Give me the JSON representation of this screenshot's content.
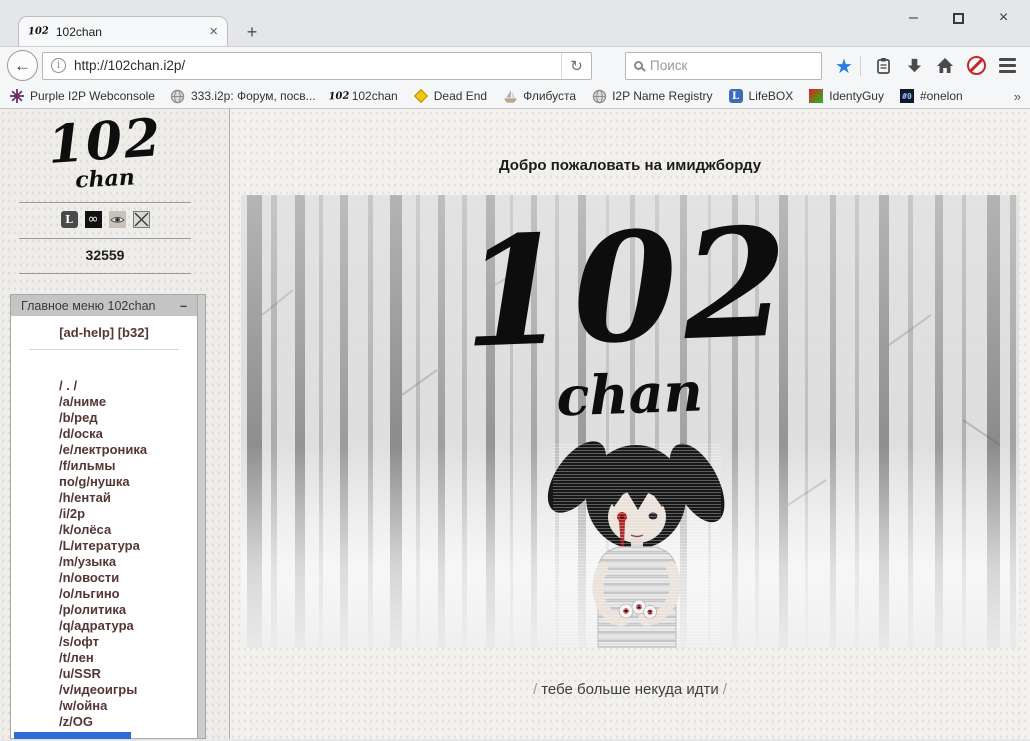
{
  "window": {
    "glyphs": {
      "minimize": "–",
      "close": "×"
    }
  },
  "browser": {
    "tab": {
      "favicon": "102",
      "title": "102chan",
      "close_glyph": "×",
      "new_tab_glyph": "+"
    },
    "nav": {
      "url": "http://102chan.i2p/",
      "search_placeholder": "Поиск"
    },
    "glyphs": {
      "back": "←",
      "reload": "↻",
      "info": "i",
      "star": "★",
      "chevron": "»"
    },
    "bookmarks": [
      {
        "label": "Purple I2P Webconsole",
        "icon": "purple-star"
      },
      {
        "label": "333.i2p: Форум, посв...",
        "icon": "globe"
      },
      {
        "label": "102chan",
        "icon": "102-favicon"
      },
      {
        "label": "Dead End",
        "icon": "yellow-diamond"
      },
      {
        "label": "Флибуста",
        "icon": "ship"
      },
      {
        "label": "I2P Name Registry",
        "icon": "globe"
      },
      {
        "label": "LifeBOX",
        "icon": "blue-L-square",
        "icon_glyph": "L"
      },
      {
        "label": "IdentyGuy",
        "icon": "red-green-square"
      },
      {
        "label": "#onelon",
        "icon": "dark-square",
        "icon_glyph": "#0"
      }
    ]
  },
  "sidebar": {
    "logo_large": "102",
    "logo_small": "chan",
    "tile_glyphs": {
      "l": "L",
      "infinity": "∞"
    },
    "counter": "32559",
    "menu": {
      "header": "Главное меню 102chan",
      "collapse_glyph": "–",
      "links": [
        "[ad-help]",
        "[b32]"
      ],
      "boards": [
        "/ . /",
        "/a/ниме",
        "/b/ред",
        "/d/оска",
        "/e/лектроника",
        "/f/ильмы",
        "по/g/нушка",
        "/h/ентай",
        "/i/2p",
        "/k/олёса",
        "/L/итература",
        "/m/узыка",
        "/n/овости",
        "/o/льгино",
        "/p/олитика",
        "/q/адратура",
        "/s/офт",
        "/t/лен",
        "/u/SSR",
        "/v/идеоигры",
        "/w/ойна",
        "/z/OG"
      ]
    }
  },
  "main": {
    "heading": "Добро пожаловать на имиджборду",
    "banner": {
      "logo_large": "102",
      "logo_small": "chan"
    },
    "footer": {
      "slash": "/",
      "text": "тебе больше некуда идти"
    }
  },
  "colors": {
    "link_maroon": "#553535",
    "star_blue": "#2d7ce0",
    "diamond_yellow": "#f2c513",
    "block_red": "#c22a2a",
    "status_blue": "#2e6bd8"
  }
}
